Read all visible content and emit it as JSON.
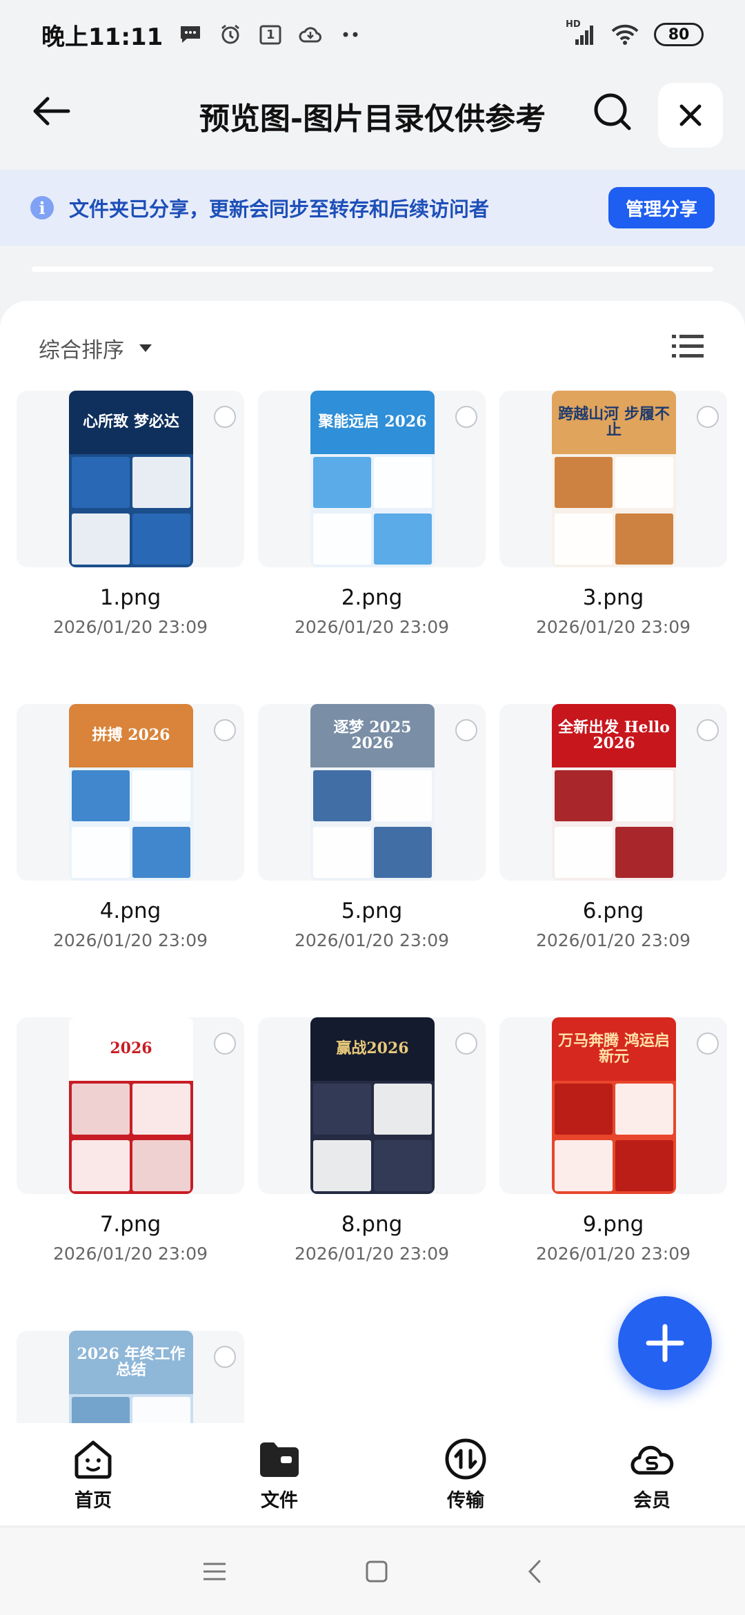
{
  "status_bar": {
    "time": "晚上11:11",
    "calendar_day": "1",
    "network_label": "HD",
    "battery": "80"
  },
  "header": {
    "title": "预览图-图片目录仅供参考"
  },
  "banner": {
    "info_glyph": "i",
    "text": "文件夹已分享，更新会同步至转存和后续访问者",
    "button_label": "管理分享"
  },
  "sort": {
    "label": "综合排序"
  },
  "files": [
    {
      "name": "1.png",
      "date": "2026/01/20 23:09",
      "headline": "心所致 梦必达",
      "colors": [
        "#0f2f5c",
        "#1c4e8c",
        "#2b6cb8"
      ],
      "text_color": "#ffffff"
    },
    {
      "name": "2.png",
      "date": "2026/01/20 23:09",
      "headline": "聚能远启 2026",
      "colors": [
        "#2f8fd8",
        "#e9f2fa",
        "#4aa3e6"
      ],
      "text_color": "#ffffff"
    },
    {
      "name": "3.png",
      "date": "2026/01/20 23:09",
      "headline": "跨越山河 步履不止",
      "colors": [
        "#e0a45c",
        "#f7f1ea",
        "#c9762f"
      ],
      "text_color": "#1f3b6e"
    },
    {
      "name": "4.png",
      "date": "2026/01/20 23:09",
      "headline": "拼搏 2026",
      "colors": [
        "#d9843a",
        "#eaf3fb",
        "#2e7bc8"
      ],
      "text_color": "#ffffff"
    },
    {
      "name": "5.png",
      "date": "2026/01/20 23:09",
      "headline": "逐梦 2025 2026",
      "colors": [
        "#7a8ea6",
        "#eef3f8",
        "#2f5f9c"
      ],
      "text_color": "#ffffff"
    },
    {
      "name": "6.png",
      "date": "2026/01/20 23:09",
      "headline": "全新出发 Hello 2026",
      "colors": [
        "#c8161d",
        "#f6eded",
        "#a10f15"
      ],
      "text_color": "#ffffff"
    },
    {
      "name": "7.png",
      "date": "2026/01/20 23:09",
      "headline": "2026",
      "colors": [
        "#ffffff",
        "#c81d24",
        "#f3e6e6"
      ],
      "text_color": "#c81d24"
    },
    {
      "name": "8.png",
      "date": "2026/01/20 23:09",
      "headline": "赢战2026",
      "colors": [
        "#151b2e",
        "#242b42",
        "#343c58"
      ],
      "text_color": "#e8c97a"
    },
    {
      "name": "9.png",
      "date": "2026/01/20 23:09",
      "headline": "万马奔腾 鸿运启新元",
      "colors": [
        "#d6281e",
        "#e8462c",
        "#b51a14"
      ],
      "text_color": "#ffe2a8"
    },
    {
      "name": "",
      "date": "",
      "headline": "2026 年终工作总结",
      "colors": [
        "#8fb7d8",
        "#c9def0",
        "#6a9cc8"
      ],
      "text_color": "#ffffff"
    }
  ],
  "bottom_nav": [
    {
      "label": "首页",
      "icon": "home-face-icon"
    },
    {
      "label": "文件",
      "icon": "folder-icon"
    },
    {
      "label": "传输",
      "icon": "transfer-icon"
    },
    {
      "label": "会员",
      "icon": "member-cloud-icon"
    }
  ],
  "accent_color": "#1e5ef0"
}
